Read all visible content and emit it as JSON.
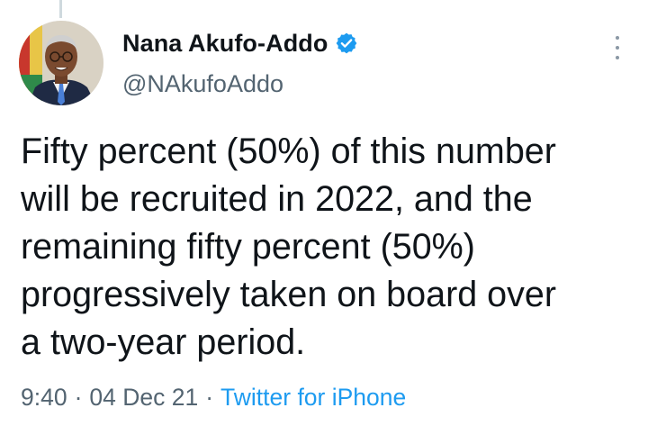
{
  "tweet": {
    "author": {
      "display_name": "Nana Akufo-Addo",
      "handle": "@NAkufoAddo",
      "verified": true
    },
    "text": "Fifty percent (50%) of this number\nwill be recruited in 2022, and the\nremaining fifty percent (50%)\nprogressively taken on board over\na two-year period.",
    "time": "9:40",
    "date": "04 Dec 21",
    "source": "Twitter for iPhone",
    "separator": "·"
  },
  "icons": {
    "verified": "verified-badge-icon",
    "more": "more-options-icon"
  },
  "colors": {
    "text": "#0f1419",
    "secondary": "#536471",
    "accent": "#1d9bf0",
    "background": "#ffffff"
  }
}
